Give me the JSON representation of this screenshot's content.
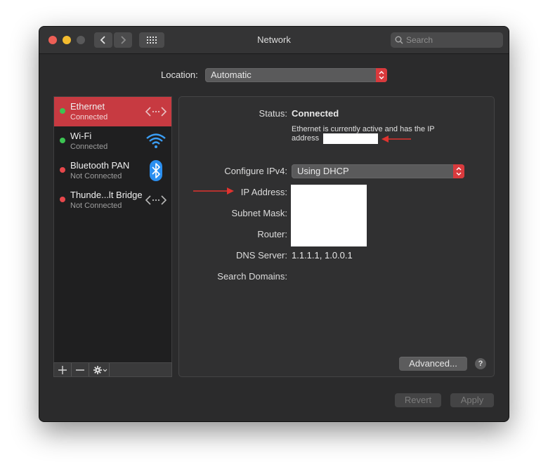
{
  "window": {
    "title": "Network"
  },
  "search": {
    "placeholder": "Search"
  },
  "location": {
    "label": "Location:",
    "value": "Automatic"
  },
  "services": [
    {
      "name": "Ethernet",
      "status": "Connected",
      "status_color": "green",
      "selected": true,
      "icon": "ethernet-arrows-icon"
    },
    {
      "name": "Wi-Fi",
      "status": "Connected",
      "status_color": "green",
      "selected": false,
      "icon": "wifi-icon"
    },
    {
      "name": "Bluetooth PAN",
      "status": "Not Connected",
      "status_color": "red",
      "selected": false,
      "icon": "bluetooth-icon"
    },
    {
      "name": "Thunde...lt Bridge",
      "status": "Not Connected",
      "status_color": "red",
      "selected": false,
      "icon": "thunderbolt-bridge-arrows-icon"
    }
  ],
  "detail": {
    "status_label": "Status:",
    "status_value": "Connected",
    "status_desc": "Ethernet is currently active and has the IP address",
    "configure_label": "Configure IPv4:",
    "configure_value": "Using DHCP",
    "ip_label": "IP Address:",
    "subnet_label": "Subnet Mask:",
    "router_label": "Router:",
    "dns_label": "DNS Server:",
    "dns_value": "1.1.1.1, 1.0.0.1",
    "search_domains_label": "Search Domains:",
    "advanced_label": "Advanced...",
    "help_label": "?"
  },
  "footer": {
    "revert_label": "Revert",
    "apply_label": "Apply"
  },
  "colors": {
    "accent": "#d93a3d",
    "selection": "#c73a41",
    "connected": "#3cc452",
    "not_connected": "#e6474b",
    "annotation_arrow": "#e0332f"
  }
}
